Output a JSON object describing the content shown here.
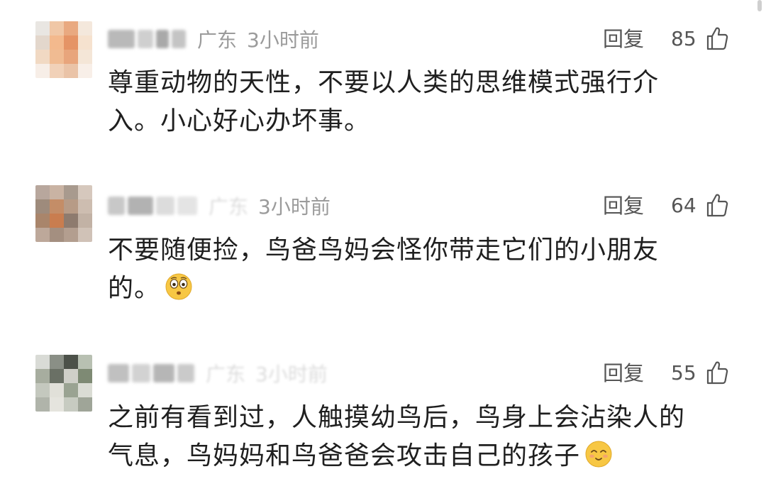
{
  "comments": [
    {
      "location": "广东",
      "time": "3小时前",
      "reply_label": "回复",
      "likes": "85",
      "text_lines": [
        "尊重动物的天性，不要以人类的思维模式强行介",
        "入。小心好心办坏事。"
      ],
      "avatar_colors": [
        "#e9e6e2",
        "#f0c7a6",
        "#e9a980",
        "#f4e8dc",
        "#e3d7cc",
        "#f3b98d",
        "#e59466",
        "#f6e2cf",
        "#f1d9c3",
        "#f0bb92",
        "#e8a57c",
        "#f4e6d7",
        "#f7eee7",
        "#f1d1b8",
        "#eac3a7",
        "#f8efe8"
      ]
    },
    {
      "location": "广东",
      "time": "3小时前",
      "reply_label": "回复",
      "likes": "64",
      "text_lines": [
        "不要随便捡，鸟爸鸟妈会怪你带走它们的小朋友",
        "的。"
      ],
      "emoji": "flushed-face-emoji",
      "avatar_colors": [
        "#b8a79d",
        "#c9b3a3",
        "#a89a8e",
        "#d6c8bd",
        "#9e8b7c",
        "#c48d67",
        "#b79b86",
        "#cdbdb0",
        "#a9856b",
        "#c97d4f",
        "#8e7b6e",
        "#c2b2a5",
        "#bda89a",
        "#a48f80",
        "#b39e8f",
        "#d0c2b7"
      ]
    },
    {
      "location": "广东",
      "time": "3小时前",
      "reply_label": "回复",
      "likes": "55",
      "text_lines": [
        "之前有看到过，人触摸幼鸟后，鸟身上会沾染人的",
        "气息，鸟妈妈和鸟爸爸会攻击自己的孩子"
      ],
      "emoji": "smiling-face-emoji",
      "avatar_colors": [
        "#d9dbd6",
        "#8a8f86",
        "#4c5149",
        "#b8c0b2",
        "#a7ad9f",
        "#6a7065",
        "#cfcfc8",
        "#7e8a74",
        "#c4c8be",
        "#e1e0d9",
        "#9aa392",
        "#dadcd4",
        "#b0b4aa",
        "#e5e4de",
        "#c7cbc1",
        "#9fa598"
      ]
    }
  ],
  "colors": {
    "meta_text": "#9b9b9b",
    "body_text": "#1f1f1f",
    "action_text": "#555555"
  }
}
